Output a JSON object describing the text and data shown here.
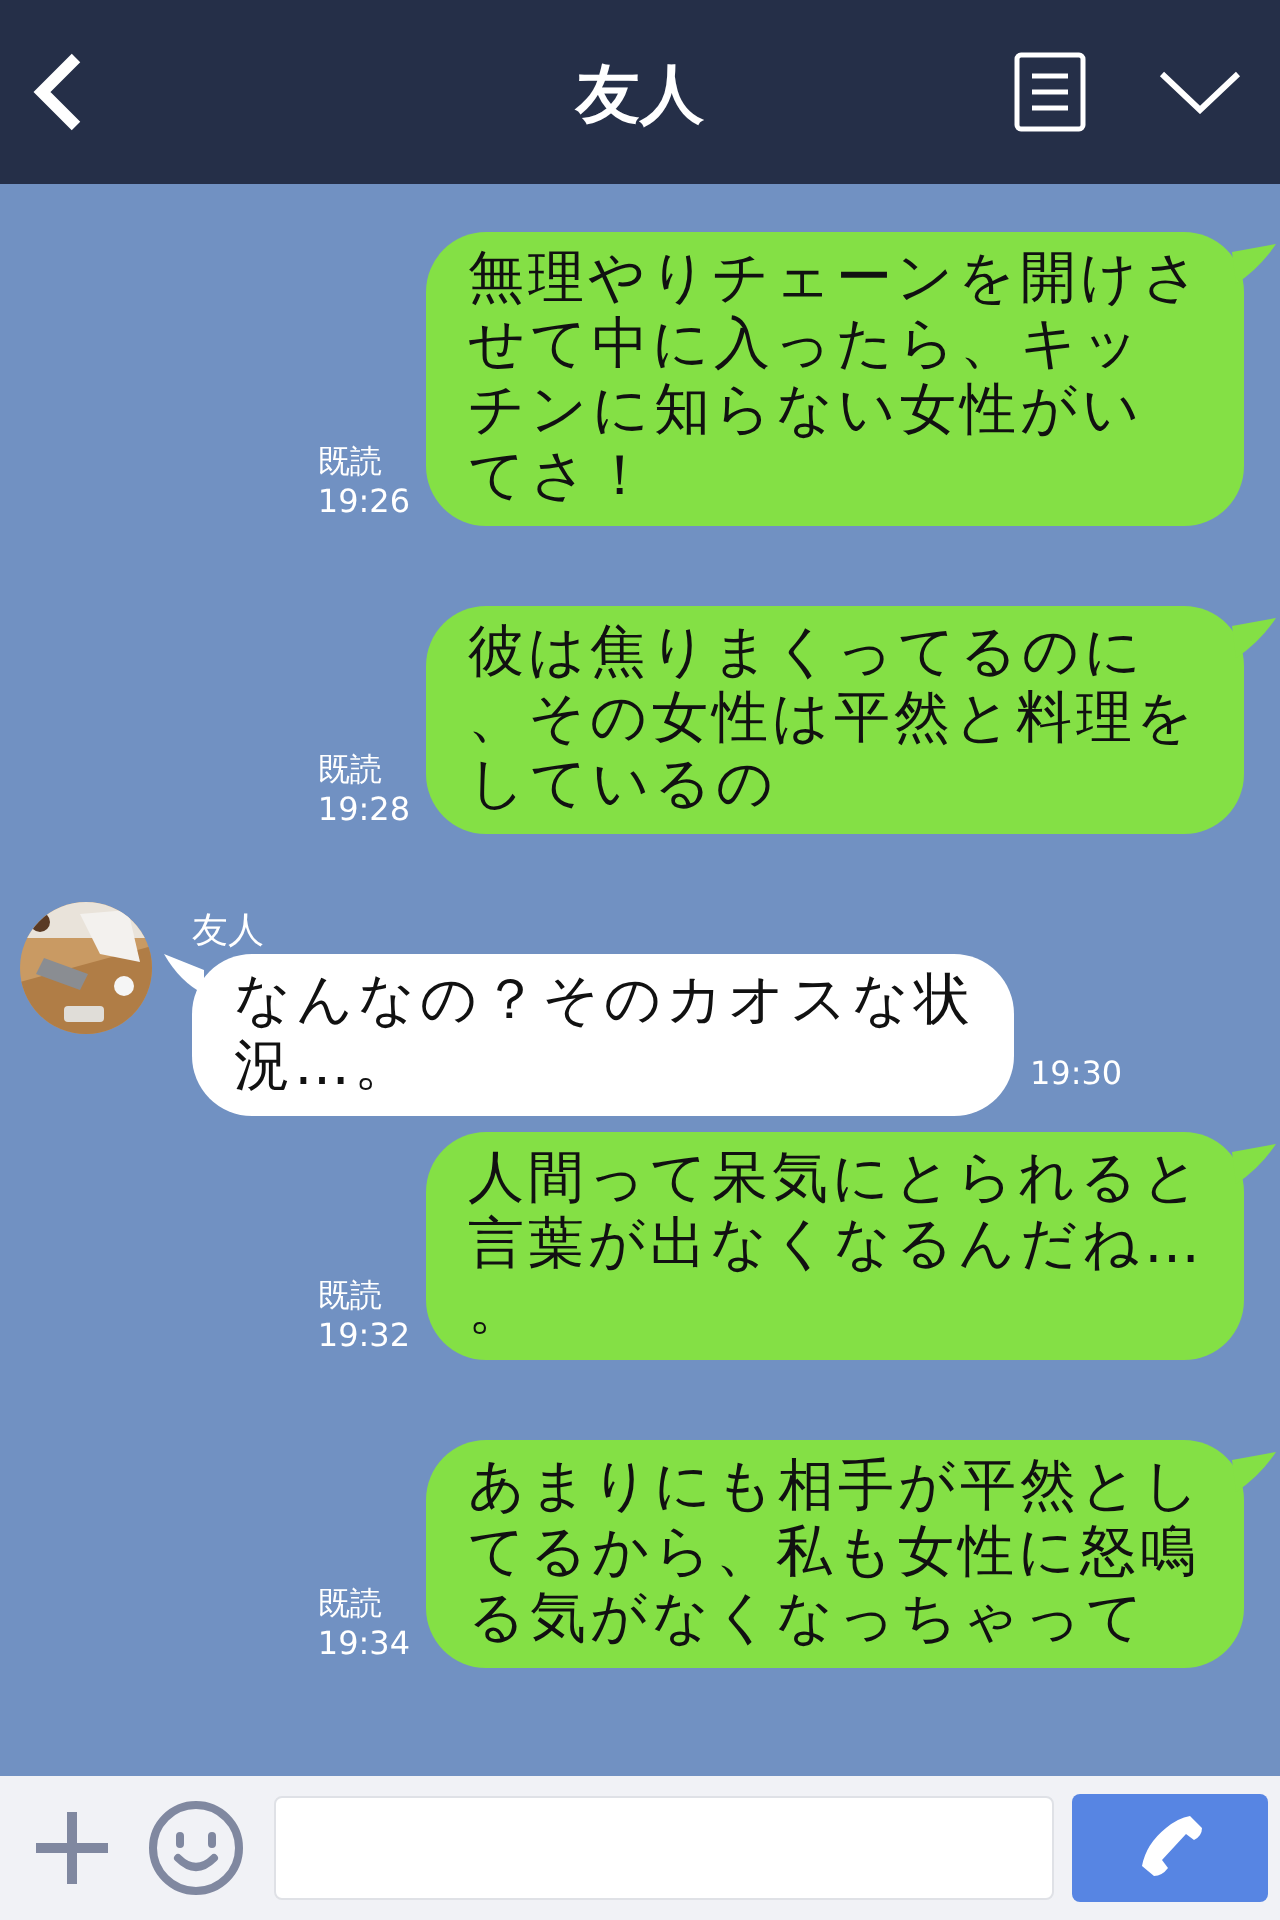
{
  "header": {
    "title": "友人"
  },
  "messages": [
    {
      "kind": "sent",
      "text": "無理やりチェーンを開けさせて中に入ったら、キッチンに知らない女性がいてさ！",
      "read": "既読",
      "time": "19:26"
    },
    {
      "kind": "sent",
      "text": "彼は焦りまくってるのに、その女性は平然と料理をしているの",
      "read": "既読",
      "time": "19:28"
    },
    {
      "kind": "received",
      "sender": "友人",
      "text": "なんなの？そのカオスな状況…。",
      "time": "19:30"
    },
    {
      "kind": "sent",
      "text": "人間って呆気にとられると言葉が出なくなるんだね…。",
      "read": "既読",
      "time": "19:32"
    },
    {
      "kind": "sent",
      "text": "あまりにも相手が平然としてるから、私も女性に怒鳴る気がなくなっちゃって",
      "read": "既読",
      "time": "19:34"
    }
  ]
}
